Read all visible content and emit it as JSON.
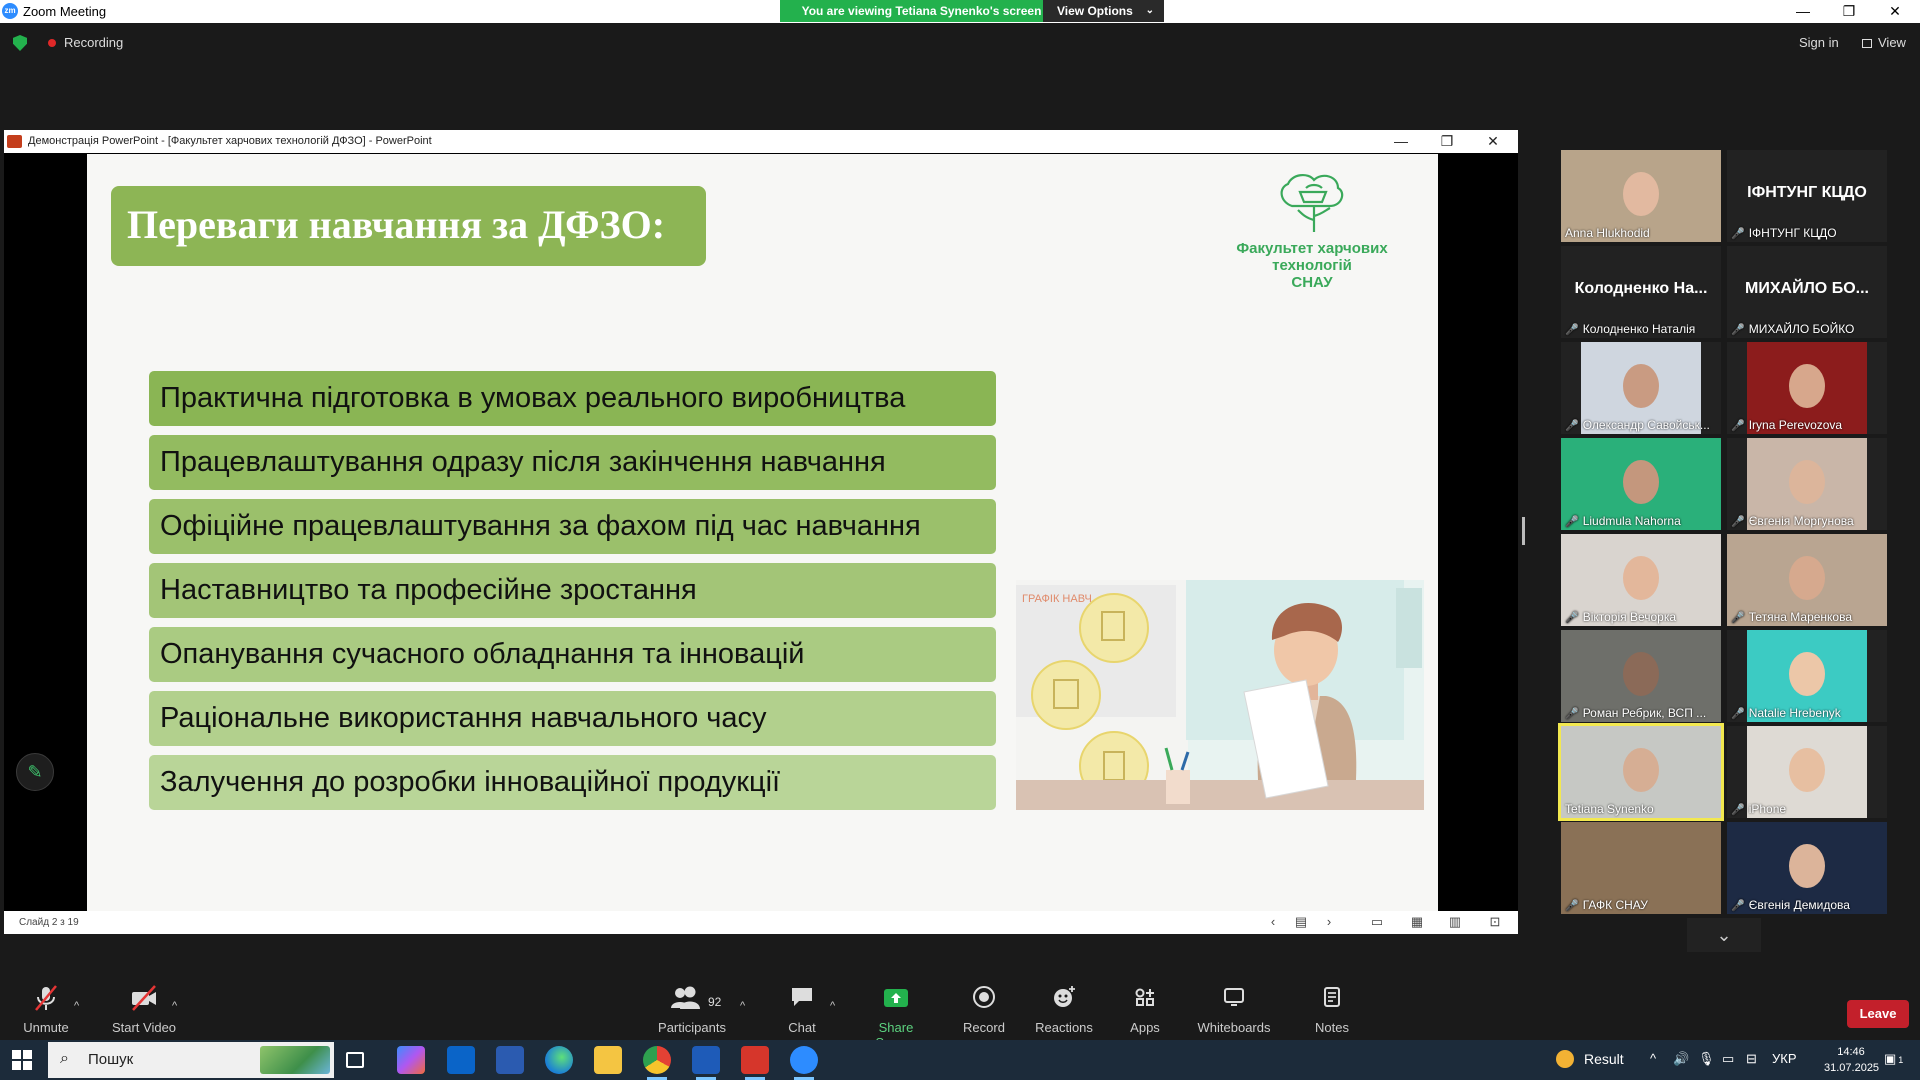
{
  "app": {
    "title": "Zoom Meeting",
    "banner": "You are viewing Tetiana Synenko's screen",
    "view_options": "View Options",
    "recording": "Recording",
    "sign_in": "Sign in",
    "view": "View"
  },
  "ppt": {
    "window_title": "Демонстрація PowerPoint - [Факультет харчових технологій ДФЗО] - PowerPoint",
    "slide_counter": "Слайд 2 з 19",
    "slide": {
      "title": "Переваги навчання за ДФЗО:",
      "logo_text_1": "Факультет харчових",
      "logo_text_2": "технологій",
      "logo_text_3": "СНАУ",
      "illustration_caption": "ГРАФІК НАВЧ...",
      "bullets": [
        "Практична підготовка в умовах реального виробництва",
        "Працевлаштування одразу після закінчення навчання",
        "Офіційне працевлаштування за фахом під час навчання",
        "Наставництво та професійне зростання",
        "Опанування сучасного обладнання та інновацій",
        "Раціональне використання навчального часу",
        "Залучення до розробки інноваційної продукції"
      ],
      "bullet_colors": [
        "#8ab554",
        "#93bb60",
        "#9bc06b",
        "#a3c577",
        "#aacb82",
        "#b2d08d",
        "#b9d598"
      ]
    }
  },
  "participants": [
    {
      "name": "Anna Hlukhodid",
      "muted": false,
      "big": "",
      "bg": "#b8a48a",
      "face": "#e2b9a0"
    },
    {
      "name": "ІФНТУНГ КЦДО",
      "muted": true,
      "big": "ІФНТУНГ КЦДО",
      "bg": "",
      "face": ""
    },
    {
      "name": "Колодненко Наталія",
      "muted": true,
      "big": "Колодненко  На...",
      "bg": "",
      "face": ""
    },
    {
      "name": "МИХАЙЛО БОЙКО",
      "muted": true,
      "big": "МИХАЙЛО БО...",
      "bg": "",
      "face": ""
    },
    {
      "name": "Олександр Савойськ...",
      "muted": true,
      "big": "",
      "bg": "#cfd6df",
      "face": "#c99b82"
    },
    {
      "name": "Iryna Perevozova",
      "muted": true,
      "big": "",
      "bg": "#8c1c1c",
      "face": "#d7a78c"
    },
    {
      "name": "Liudmula Nahorna",
      "muted": true,
      "big": "",
      "bg": "#2ab07a",
      "face": "#c4977d"
    },
    {
      "name": "Євгенія Моргунова",
      "muted": true,
      "big": "",
      "bg": "#c9b6a8",
      "face": "#dcb59b"
    },
    {
      "name": "Вікторія Вечорка",
      "muted": true,
      "big": "",
      "bg": "#d9d4cf",
      "face": "#e3b79b"
    },
    {
      "name": "Тетяна Маренкова",
      "muted": true,
      "big": "",
      "bg": "#b9a591",
      "face": "#d6a98e"
    },
    {
      "name": "Роман Ребрик, ВСП ...",
      "muted": true,
      "big": "",
      "bg": "#6e6f6a",
      "face": "#8b6a58"
    },
    {
      "name": "Natalie Hrebenyk",
      "muted": true,
      "big": "",
      "bg": "#3ccbc3",
      "face": "#ecc7a8"
    },
    {
      "name": "Tetiana Synenko",
      "muted": false,
      "big": "",
      "bg": "#c6c8c4",
      "face": "#d6ae94"
    },
    {
      "name": "iPhone",
      "muted": true,
      "big": "",
      "bg": "#dedad4",
      "face": "#e7bfa1"
    },
    {
      "name": "ГАФК СНАУ",
      "muted": true,
      "big": "",
      "bg": "#8a7156",
      "face": ""
    },
    {
      "name": "Євгенія Демидова",
      "muted": true,
      "big": "",
      "bg": "#1d2a44",
      "face": "#dcb49a"
    }
  ],
  "toolbar": {
    "unmute": "Unmute",
    "start_video": "Start Video",
    "participants": "Participants",
    "participant_count": "92",
    "chat": "Chat",
    "share_screen": "Share Screen",
    "record": "Record",
    "reactions": "Reactions",
    "apps": "Apps",
    "whiteboards": "Whiteboards",
    "notes": "Notes",
    "leave": "Leave"
  },
  "taskbar": {
    "search": "Пошук",
    "weather": "Result",
    "lang": "УКР",
    "time": "14:46",
    "date": "31.07.2025",
    "notifications": "1"
  }
}
